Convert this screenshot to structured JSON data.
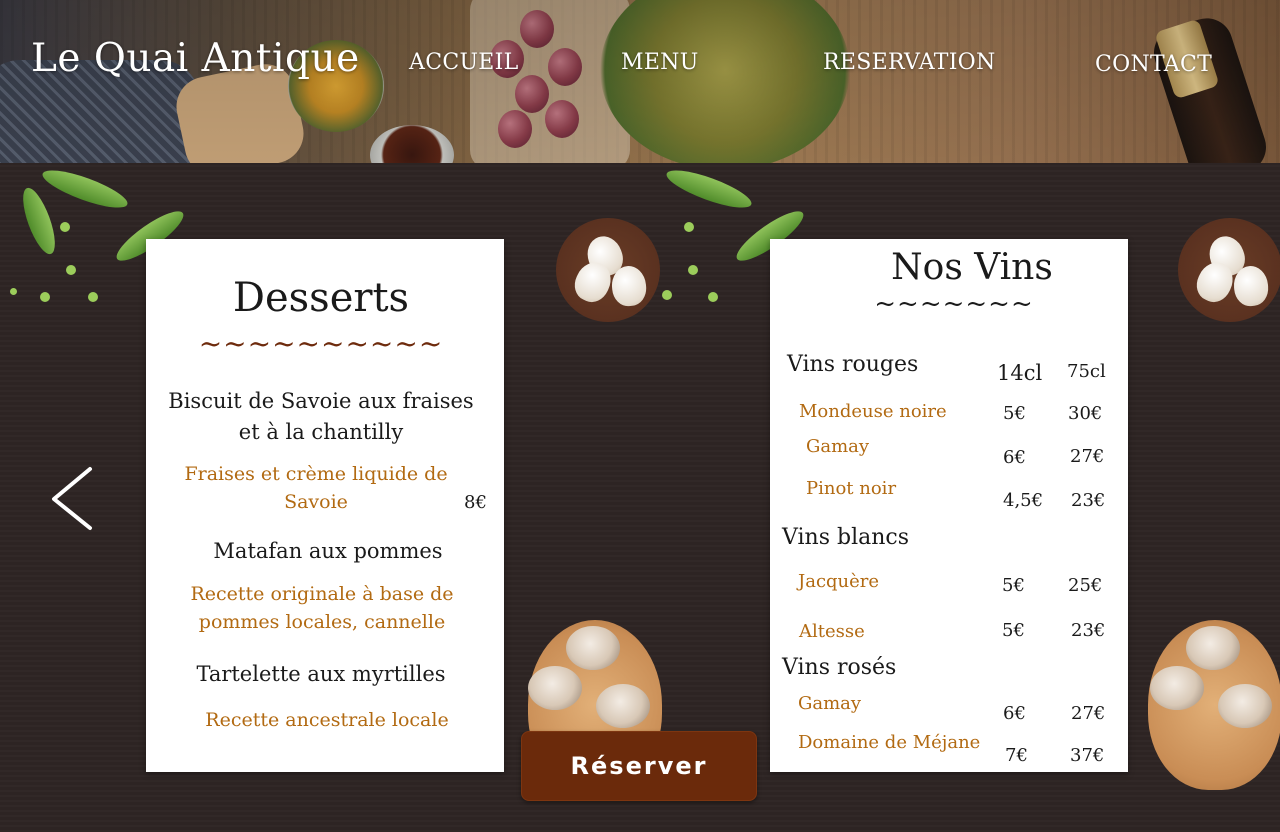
{
  "brand": {
    "name": "Le Quai Antique"
  },
  "nav": {
    "items": [
      {
        "label": "ACCUEIL"
      },
      {
        "label": "MENU"
      },
      {
        "label": "RESERVATION"
      },
      {
        "label": "CONTACT"
      }
    ]
  },
  "desserts": {
    "title": "Desserts",
    "divider": "~~~~~~~~~~",
    "items": [
      {
        "name_line1": "Biscuit de Savoie aux fraises",
        "name_line2": "et à la chantilly",
        "desc_line1": "Fraises et crème liquide de",
        "desc_line2": "Savoie",
        "price": "8€"
      },
      {
        "name_line1": "Matafan aux pommes",
        "desc_line1": "Recette originale à base de",
        "desc_line2": "pommes locales, cannelle"
      },
      {
        "name_line1": "Tartelette aux myrtilles",
        "desc_line1": "Recette ancestrale locale"
      }
    ]
  },
  "wines": {
    "title": "Nos Vins",
    "divider": "~~~~~~~",
    "col_small": "14cl",
    "col_large": "75cl",
    "sections": [
      {
        "name": "Vins rouges",
        "items": [
          {
            "name": "Mondeuse noire",
            "small": "5€",
            "large": "30€"
          },
          {
            "name": "Gamay",
            "small": "6€",
            "large": "27€"
          },
          {
            "name": "Pinot noir",
            "small": "4,5€",
            "large": "23€"
          }
        ]
      },
      {
        "name": "Vins blancs",
        "items": [
          {
            "name": "Jacquère",
            "small": "5€",
            "large": "25€"
          },
          {
            "name": "Altesse",
            "small": "5€",
            "large": "23€"
          }
        ]
      },
      {
        "name": "Vins rosés",
        "items": [
          {
            "name": "Gamay",
            "small": "6€",
            "large": "27€"
          },
          {
            "name": "Domaine de Méjane",
            "small": "7€",
            "large": "37€"
          }
        ]
      }
    ]
  },
  "actions": {
    "reserve_label": "Réserver"
  },
  "icons": {
    "prev": "chevron-left-icon"
  },
  "colors": {
    "accent": "#b26a12",
    "button": "#6b2a0b",
    "background": "#2d2423"
  }
}
